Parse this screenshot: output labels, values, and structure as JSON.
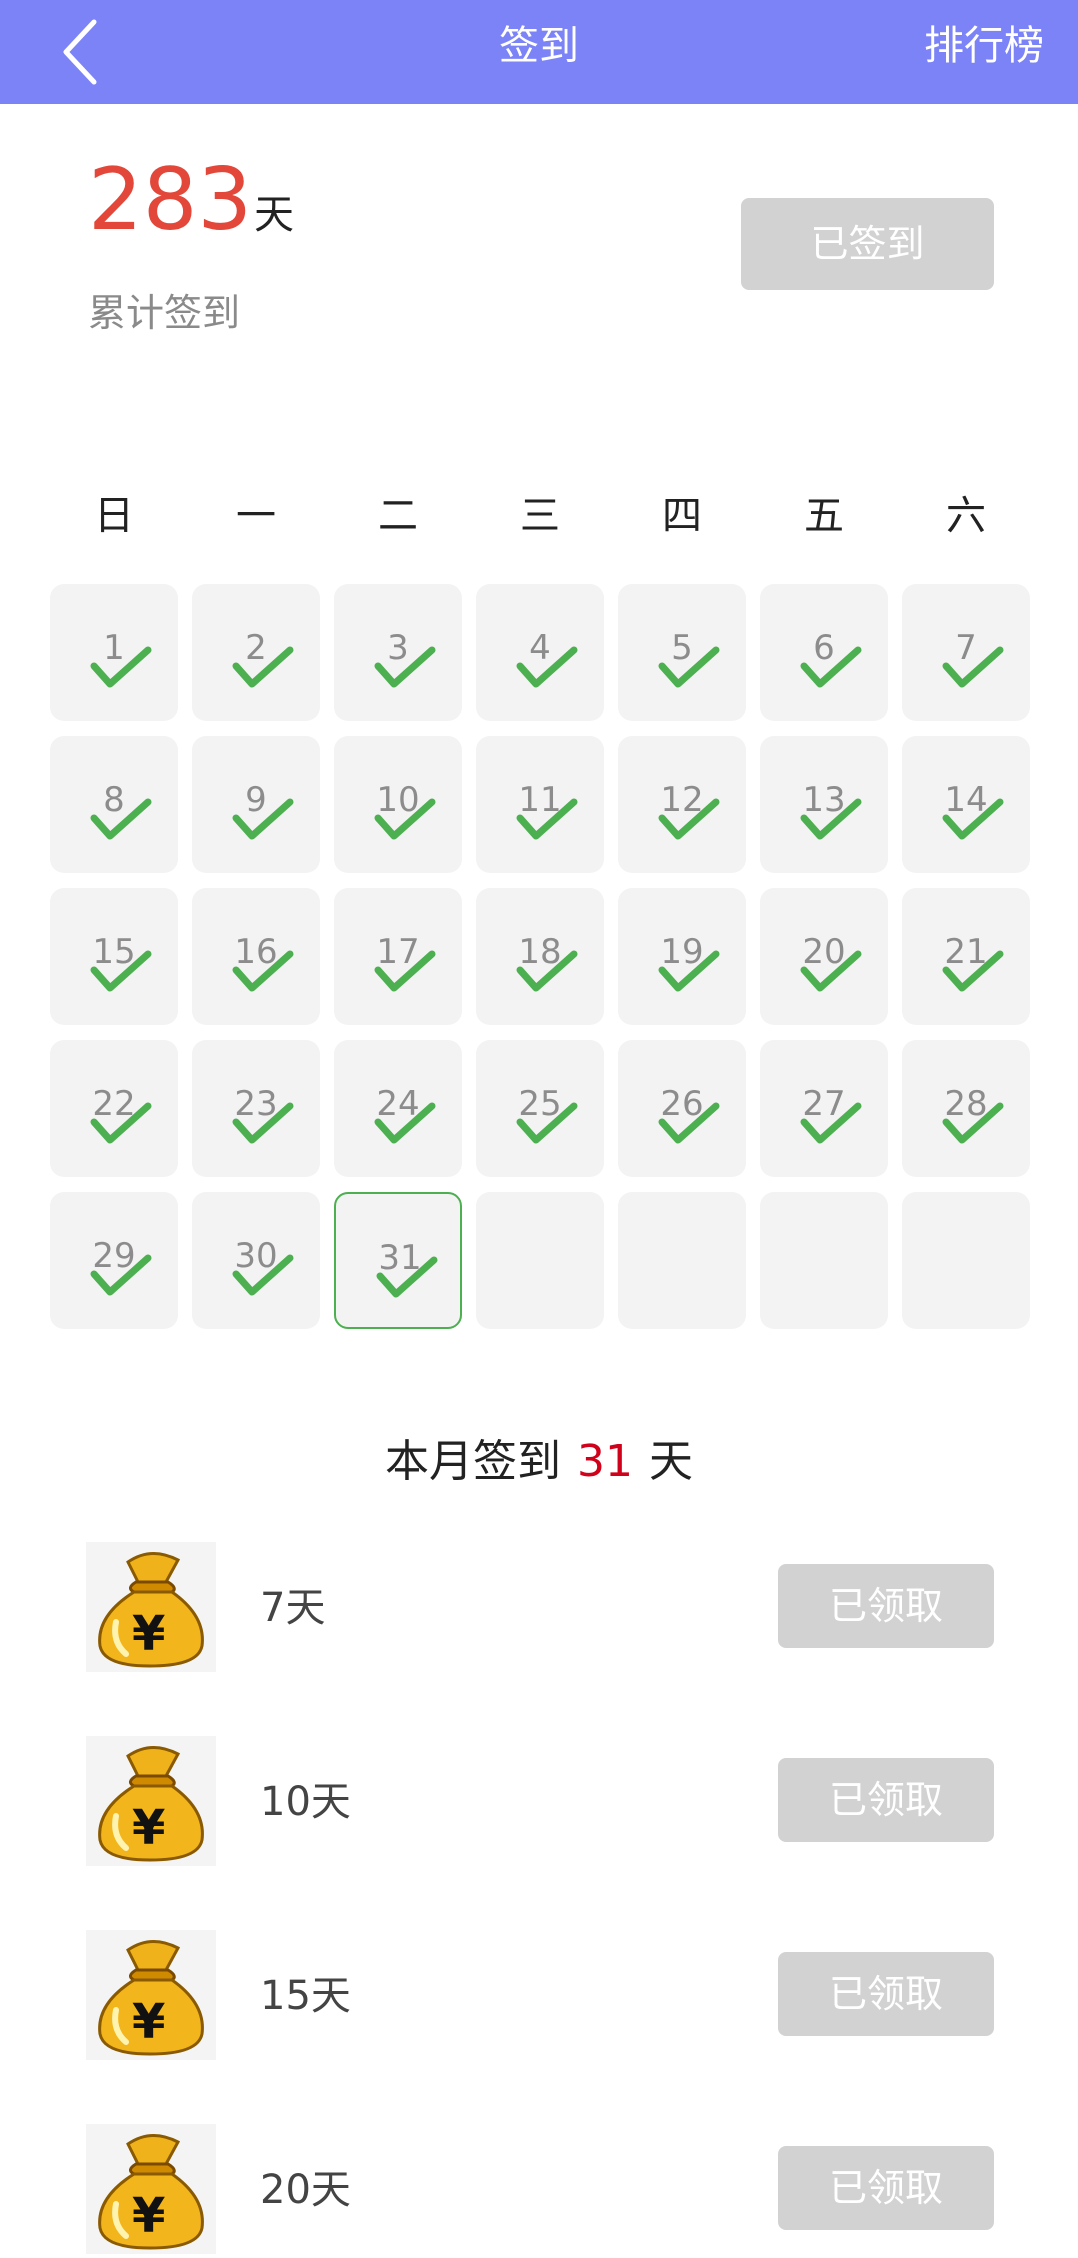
{
  "header": {
    "title": "签到",
    "ranking_label": "排行榜",
    "back_icon": "chevron-left-icon",
    "background": "#7b83f7"
  },
  "summary": {
    "total_days": "283",
    "unit": "天",
    "label": "累计签到",
    "signed_button": "已签到"
  },
  "calendar": {
    "weekdays": [
      "日",
      "一",
      "二",
      "三",
      "四",
      "五",
      "六"
    ],
    "days": [
      "1",
      "2",
      "3",
      "4",
      "5",
      "6",
      "7",
      "8",
      "9",
      "10",
      "11",
      "12",
      "13",
      "14",
      "15",
      "16",
      "17",
      "18",
      "19",
      "20",
      "21",
      "22",
      "23",
      "24",
      "25",
      "26",
      "27",
      "28",
      "29",
      "30",
      "31"
    ],
    "checked_through": 31,
    "today": "31",
    "empty_cells": 4,
    "check_color": "#4caf50"
  },
  "month": {
    "prefix": "本月签到",
    "count": "31",
    "suffix": "天"
  },
  "rewards": [
    {
      "label": "7天",
      "button": "已领取",
      "icon": "money-bag-icon"
    },
    {
      "label": "10天",
      "button": "已领取",
      "icon": "money-bag-icon"
    },
    {
      "label": "15天",
      "button": "已领取",
      "icon": "money-bag-icon"
    },
    {
      "label": "20天",
      "button": "已领取",
      "icon": "money-bag-icon"
    }
  ]
}
